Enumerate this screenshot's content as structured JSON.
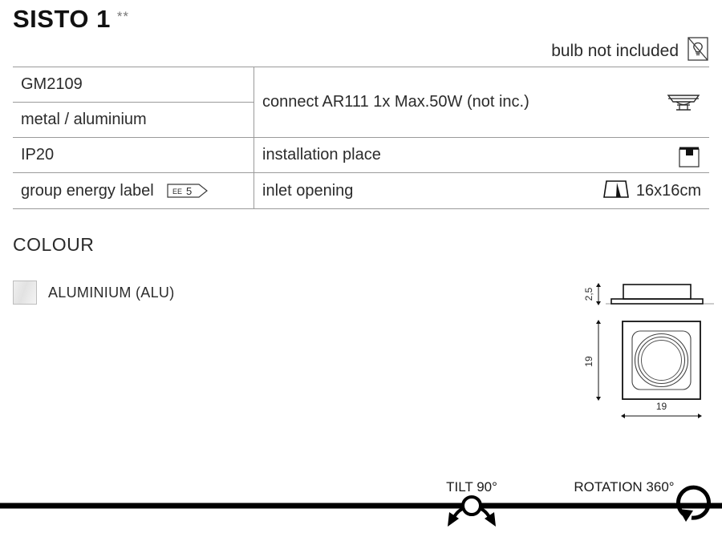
{
  "header": {
    "title": "SISTO 1",
    "stars": "**",
    "bulb_note": "bulb not included",
    "bulb_icon": "bulb-not-included-icon"
  },
  "spec_table": {
    "left_column": [
      {
        "label": "GM2109"
      },
      {
        "label": "metal / aluminium"
      },
      {
        "label": "IP20"
      },
      {
        "label": "group energy label",
        "badge_prefix": "EE",
        "badge_value": "5"
      }
    ],
    "right_column": [
      {
        "label": "connect AR111 1x Max.50W (not inc.)",
        "icon": "ar111-lamp-icon",
        "value": ""
      },
      {
        "label": "installation place",
        "icon": "ceiling-mount-icon",
        "value": ""
      },
      {
        "label": "inlet opening",
        "icon": "inlet-opening-icon",
        "value": "16x16cm"
      }
    ]
  },
  "colour": {
    "heading": "COLOUR",
    "items": [
      {
        "name": "ALUMINIUM (ALU)",
        "swatch_hex": "#e8e8e8"
      }
    ]
  },
  "drawings": {
    "side_view_height": "2,5",
    "plan_view_height": "19",
    "plan_view_width": "19"
  },
  "features": [
    {
      "label": "TILT 90°",
      "icon": "tilt-icon"
    },
    {
      "label": "ROTATION 360°",
      "icon": "rotation-icon"
    }
  ],
  "colors": {
    "rule": "#9a9a9a",
    "text": "#2b2b2b",
    "bar": "#000000"
  }
}
